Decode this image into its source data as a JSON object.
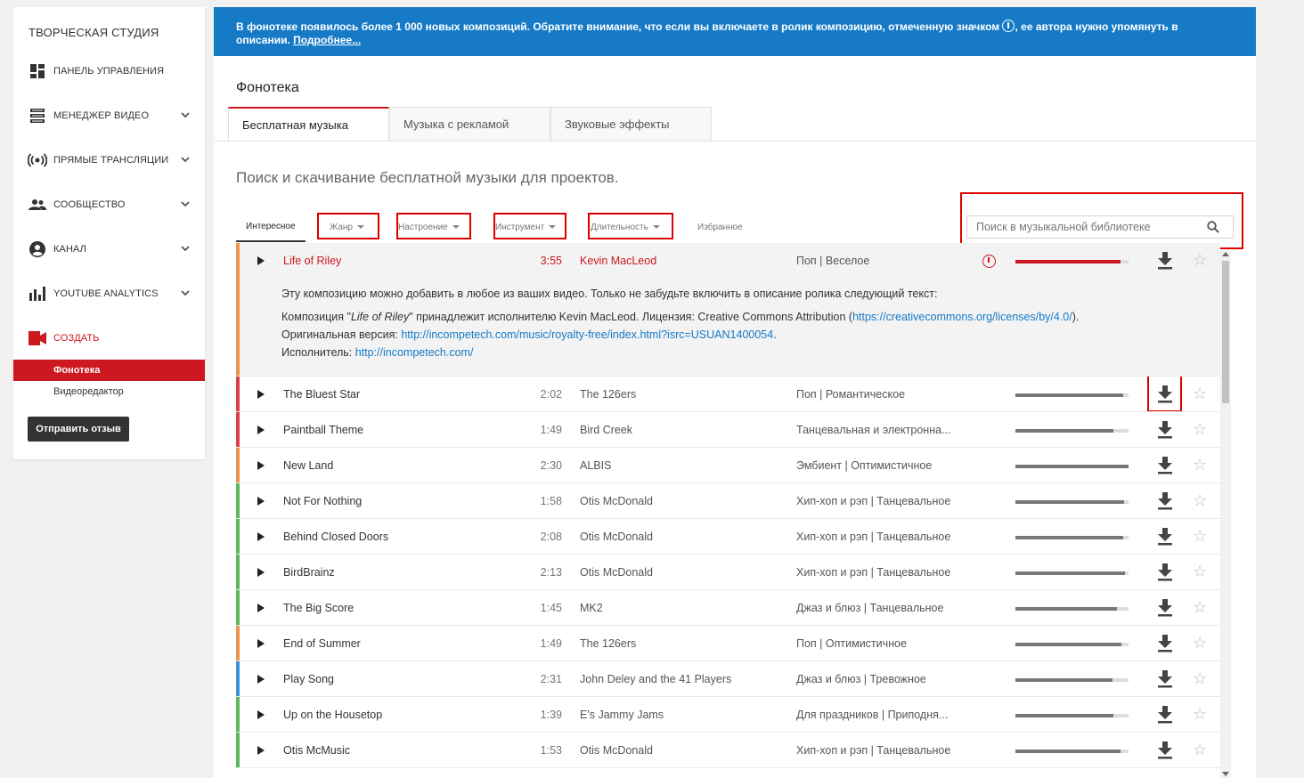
{
  "sidebar": {
    "title": "ТВОРЧЕСКАЯ СТУДИЯ",
    "items": [
      {
        "label": "ПАНЕЛЬ УПРАВЛЕНИЯ",
        "icon": "dashboard-icon"
      },
      {
        "label": "МЕНЕДЖЕР ВИДЕО",
        "icon": "video-manager-icon"
      },
      {
        "label": "ПРЯМЫЕ ТРАНСЛЯЦИИ",
        "icon": "live-icon"
      },
      {
        "label": "СООБЩЕСТВО",
        "icon": "community-icon"
      },
      {
        "label": "КАНАЛ",
        "icon": "channel-icon"
      },
      {
        "label": "YOUTUBE ANALYTICS",
        "icon": "analytics-icon"
      },
      {
        "label": "СОЗДАТЬ",
        "icon": "create-icon"
      }
    ],
    "subitems": [
      "Фонотека",
      "Видеоредактор"
    ],
    "feedback_label": "Отправить отзыв"
  },
  "banner": {
    "text_before": "В фонотеке появилось более 1 000 новых композиций. Обратите внимание, что если вы включаете в ролик композицию, отмеченную значком ",
    "text_after": ", ее автора нужно упомянуть в описании. ",
    "link": "Подробнее..."
  },
  "page": {
    "title": "Фонотека",
    "tabs": [
      "Бесплатная музыка",
      "Музыка с рекламой",
      "Звуковые эффекты"
    ],
    "subtitle": "Поиск и скачивание бесплатной музыки для проектов."
  },
  "filters": [
    "Интересное",
    "Жанр",
    "Настроение",
    "Инструмент",
    "Длительность",
    "Избранное"
  ],
  "search": {
    "placeholder": "Поиск в музыкальной библиотеке"
  },
  "expanded": {
    "title": "Life of Riley",
    "duration": "3:55",
    "artist": "Kevin MacLeod",
    "genre": "Поп | Веселое",
    "popularity": 0.93,
    "line1": "Эту композицию можно добавить в любое из ваших видео. Только не забудьте включить в описание ролика следующий текст:",
    "line2_a": "Композиция \"",
    "line2_title": "Life of Riley",
    "line2_b": "\" принадлежит исполнителю Kevin MacLeod. Лицензия: Creative Commons Attribution (",
    "line2_link": "https://creativecommons.org/licenses/by/4.0/",
    "line2_c": ").",
    "line3_label": "Оригинальная версия: ",
    "line3_link": "http://incompetech.com/music/royalty-free/index.html?isrc=USUAN1400054",
    "line3_c": ".",
    "line4_label": "Исполнитель: ",
    "line4_link": "http://incompetech.com/"
  },
  "tracks": [
    {
      "title": "The Bluest Star",
      "duration": "2:02",
      "artist": "The 126ers",
      "genre": "Поп | Романтическое",
      "popularity": 0.95,
      "color": "#d94343"
    },
    {
      "title": "Paintball Theme",
      "duration": "1:49",
      "artist": "Bird Creek",
      "genre": "Танцевальная и электронна...",
      "popularity": 0.87,
      "color": "#d94343"
    },
    {
      "title": "New Land",
      "duration": "2:30",
      "artist": "ALBIS",
      "genre": "Эмбиент | Оптимистичное",
      "popularity": 1.0,
      "color": "#e9954c"
    },
    {
      "title": "Not For Nothing",
      "duration": "1:58",
      "artist": "Otis McDonald",
      "genre": "Хип-хоп и рэп | Танцевальное",
      "popularity": 0.96,
      "color": "#5cb85c"
    },
    {
      "title": "Behind Closed Doors",
      "duration": "2:08",
      "artist": "Otis McDonald",
      "genre": "Хип-хоп и рэп | Танцевальное",
      "popularity": 0.95,
      "color": "#5cb85c"
    },
    {
      "title": "BirdBrainz",
      "duration": "2:13",
      "artist": "Otis McDonald",
      "genre": "Хип-хоп и рэп | Танцевальное",
      "popularity": 0.97,
      "color": "#5cb85c"
    },
    {
      "title": "The Big Score",
      "duration": "1:45",
      "artist": "MK2",
      "genre": "Джаз и блюз | Танцевальное",
      "popularity": 0.9,
      "color": "#5cb85c"
    },
    {
      "title": "End of Summer",
      "duration": "1:49",
      "artist": "The 126ers",
      "genre": "Поп | Оптимистичное",
      "popularity": 0.94,
      "color": "#e9954c"
    },
    {
      "title": "Play Song",
      "duration": "2:31",
      "artist": "John Deley and the 41 Players",
      "genre": "Джаз и блюз | Тревожное",
      "popularity": 0.86,
      "color": "#3d8fd6"
    },
    {
      "title": "Up on the Housetop",
      "duration": "1:39",
      "artist": "E's Jammy Jams",
      "genre": "Для праздников | Приподня...",
      "popularity": 0.87,
      "color": "#5cb85c"
    },
    {
      "title": "Otis McMusic",
      "duration": "1:53",
      "artist": "Otis McDonald",
      "genre": "Хип-хоп и рэп | Танцевальное",
      "popularity": 0.93,
      "color": "#5cb85c"
    }
  ],
  "colors": {
    "accent": "#cc181e",
    "banner": "#167ac6",
    "expanded_stripe": "#e9954c"
  }
}
